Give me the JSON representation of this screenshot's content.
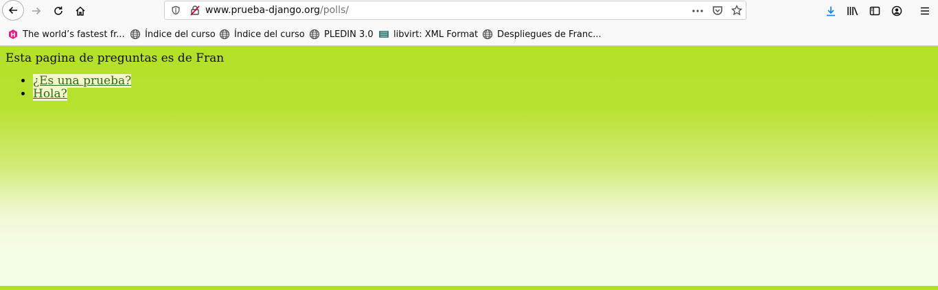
{
  "browser": {
    "url_host": "www.prueba-django.org",
    "url_path": "/polls/"
  },
  "bookmarks": [
    {
      "label": "The world’s fastest fr...",
      "icon": "hive-icon"
    },
    {
      "label": "Índice del curso",
      "icon": "globe-icon"
    },
    {
      "label": "Índice del curso",
      "icon": "globe-icon"
    },
    {
      "label": "PLEDIN 3.0",
      "icon": "globe-icon"
    },
    {
      "label": "libvirt: XML Format",
      "icon": "libvirt-icon"
    },
    {
      "label": "Despliegues de Franc...",
      "icon": "globe-icon"
    }
  ],
  "page": {
    "heading": "Esta pagina de preguntas es de Fran",
    "polls": [
      {
        "text": "¿Es una prueba?"
      },
      {
        "text": "Hola?"
      }
    ]
  },
  "colors": {
    "page_green": "#b4e028",
    "link": "#2b6d15",
    "download_blue": "#0a84ff"
  }
}
